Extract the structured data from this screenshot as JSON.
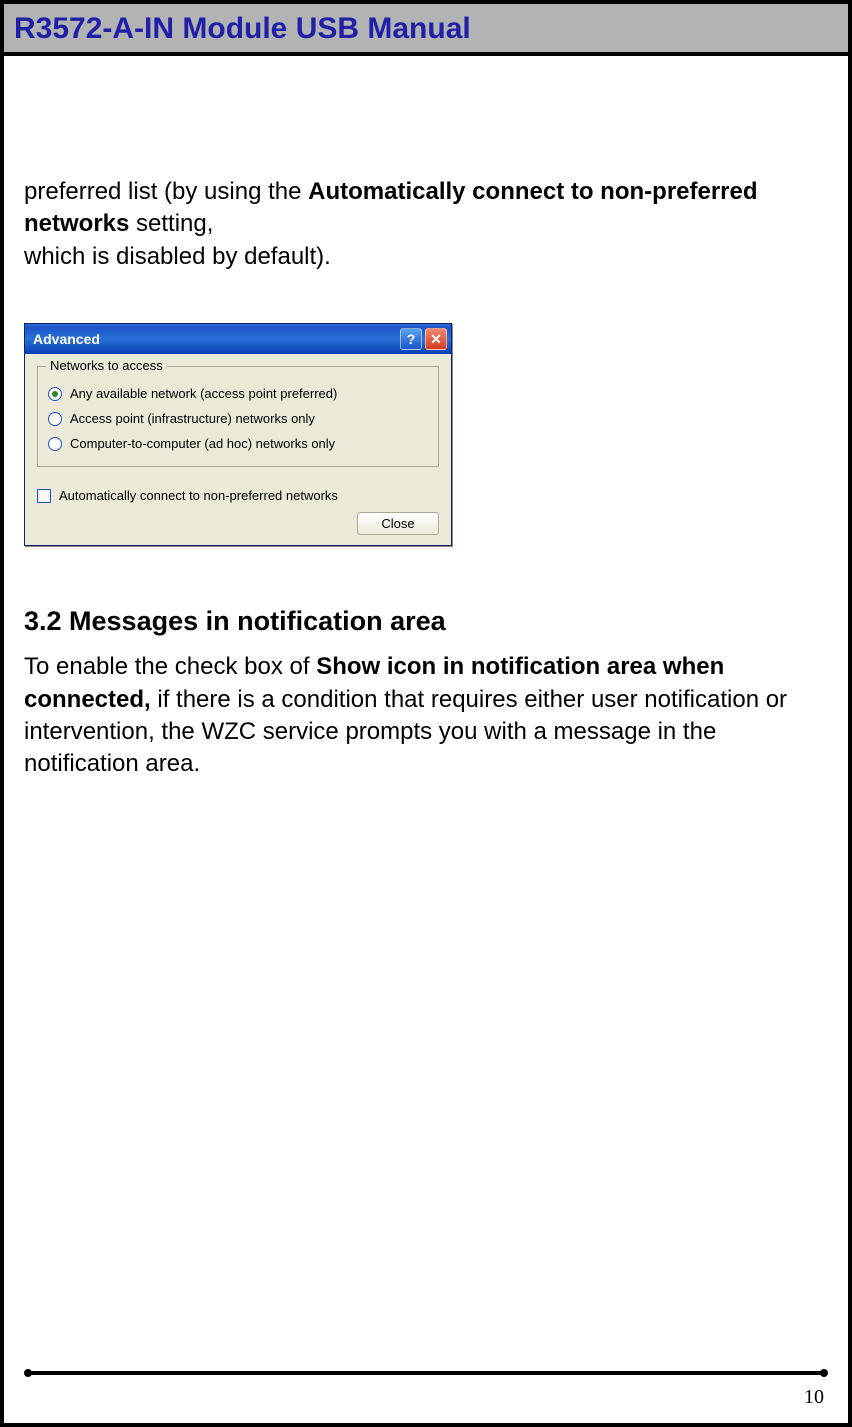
{
  "header": {
    "title": "R3572-A-IN Module USB Manual"
  },
  "intro": {
    "line1_prefix": "preferred list (by using the ",
    "line1_bold": "Automatically connect to non-preferred networks",
    "line1_suffix": " setting,",
    "line2": "which is disabled by default)."
  },
  "dialog": {
    "title": "Advanced",
    "help_glyph": "?",
    "close_glyph": "✕",
    "group_legend": "Networks to access",
    "radios": [
      {
        "label": "Any available network (access point preferred)",
        "checked": true
      },
      {
        "label": "Access point (infrastructure) networks only",
        "checked": false
      },
      {
        "label": "Computer-to-computer (ad hoc) networks only",
        "checked": false
      }
    ],
    "checkbox_label": "Automatically connect to non-preferred networks",
    "close_button": "Close"
  },
  "section": {
    "heading": "3.2 Messages in notification area",
    "p_prefix": "To enable the check box of ",
    "p_bold": "Show icon in notification area when connected,",
    "p_suffix": " if there is a condition that requires either user notification or intervention, the WZC service prompts you with a message in the notification area."
  },
  "page_number": "10"
}
